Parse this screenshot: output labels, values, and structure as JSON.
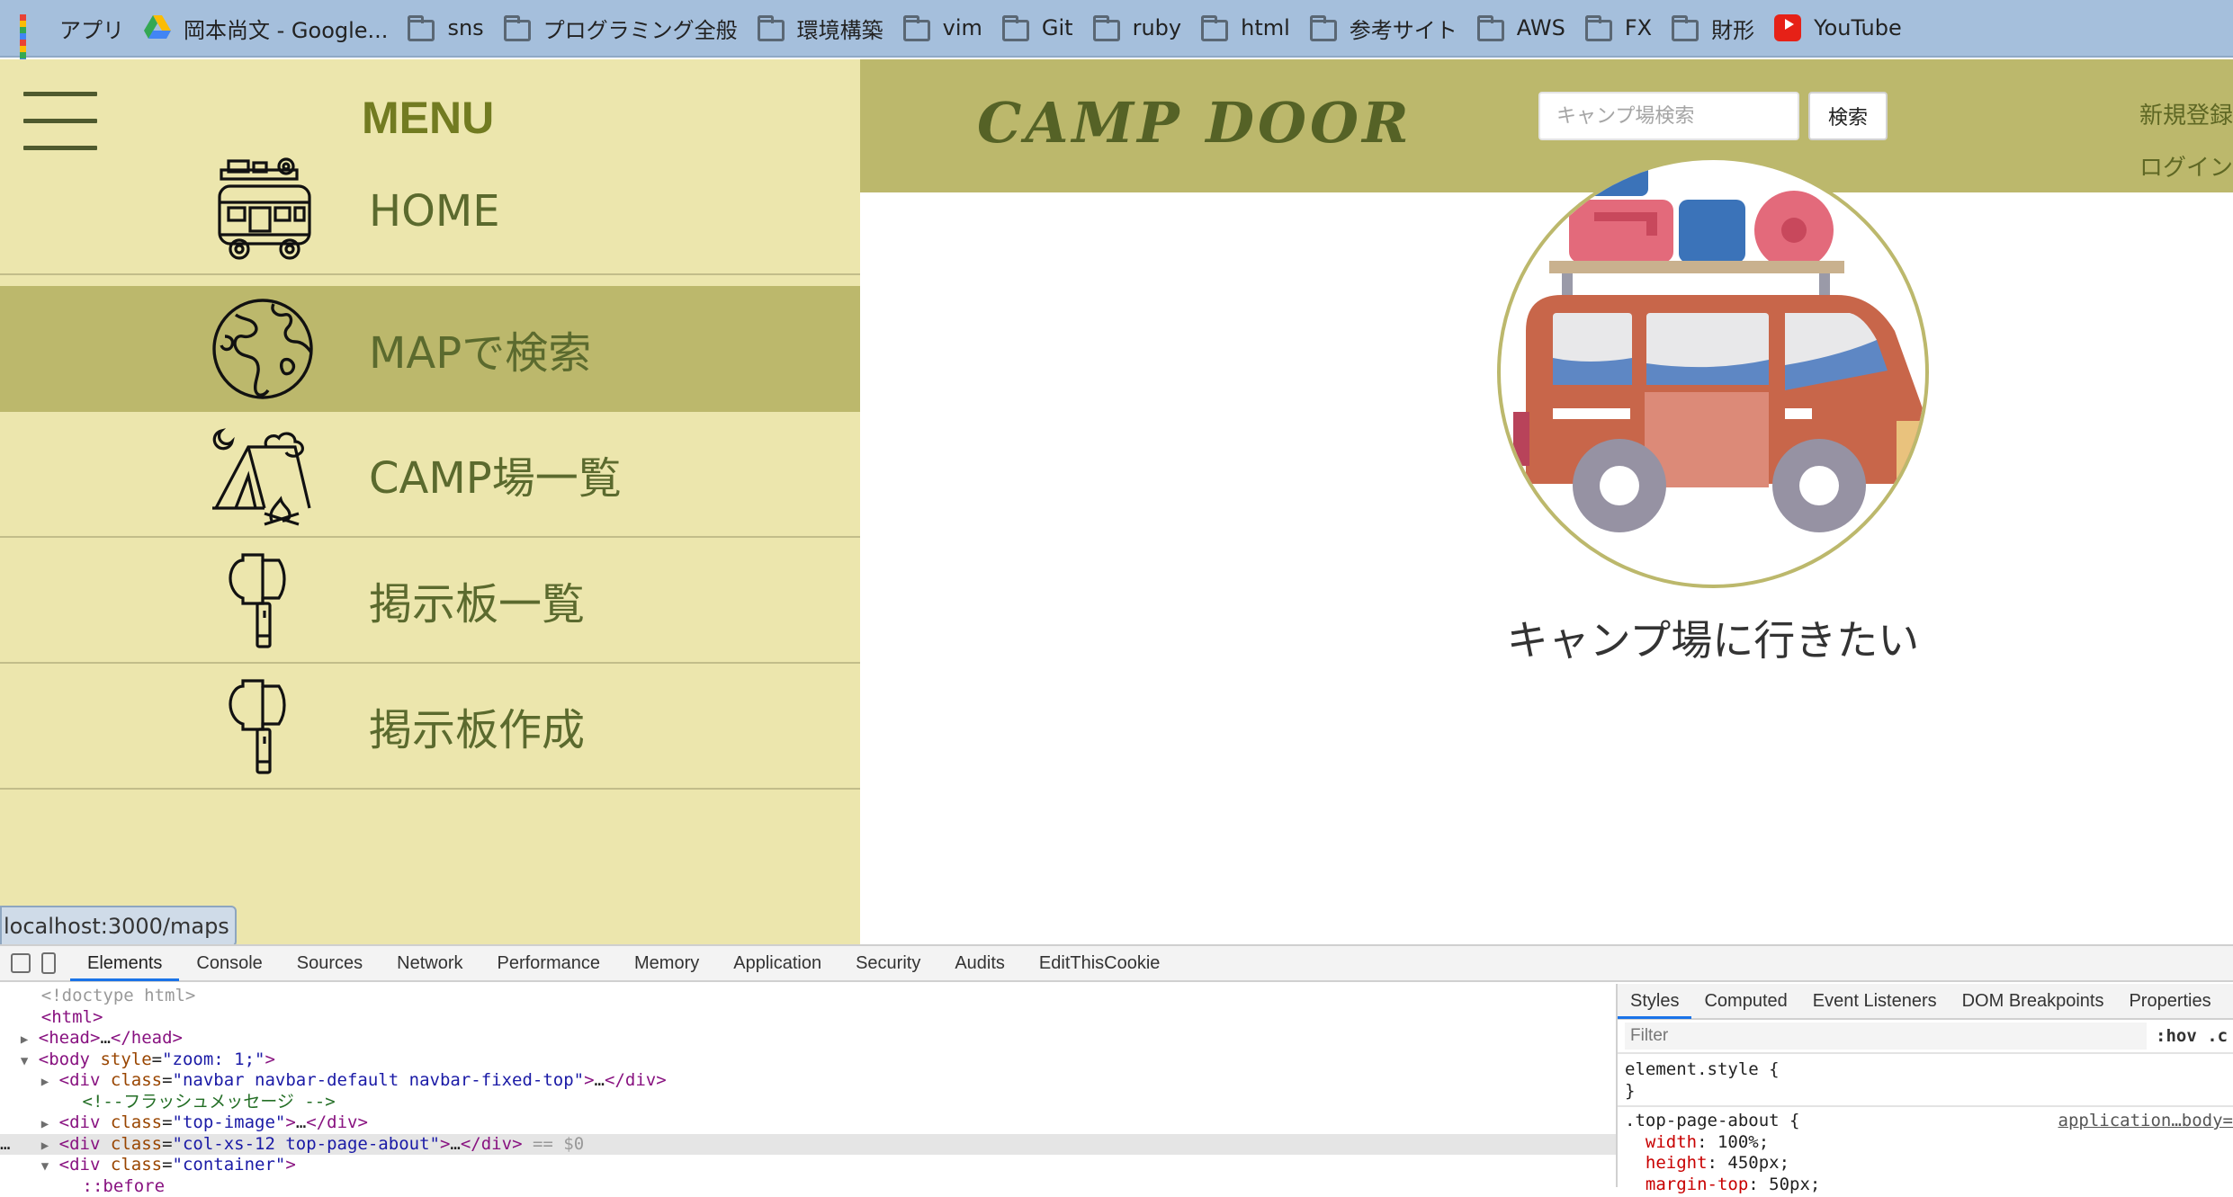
{
  "bookmarks": [
    {
      "label": "アプリ",
      "icon": "apps-grid-icon"
    },
    {
      "label": "岡本尚文 - Google...",
      "icon": "google-drive-icon"
    },
    {
      "label": "sns",
      "icon": "folder-icon"
    },
    {
      "label": "プログラミング全般",
      "icon": "folder-icon"
    },
    {
      "label": "環境構築",
      "icon": "folder-icon"
    },
    {
      "label": "vim",
      "icon": "folder-icon"
    },
    {
      "label": "Git",
      "icon": "folder-icon"
    },
    {
      "label": "ruby",
      "icon": "folder-icon"
    },
    {
      "label": "html",
      "icon": "folder-icon"
    },
    {
      "label": "参考サイト",
      "icon": "folder-icon"
    },
    {
      "label": "AWS",
      "icon": "folder-icon"
    },
    {
      "label": "FX",
      "icon": "folder-icon"
    },
    {
      "label": "財形",
      "icon": "folder-icon"
    },
    {
      "label": "YouTube",
      "icon": "youtube-icon"
    }
  ],
  "sidebar": {
    "title": "MENU",
    "items": [
      {
        "label": "HOME",
        "icon": "van-icon"
      },
      {
        "label": "MAPで検索",
        "icon": "globe-icon"
      },
      {
        "label": "CAMP場一覧",
        "icon": "tent-campfire-icon"
      },
      {
        "label": "掲示板一覧",
        "icon": "axe-icon"
      },
      {
        "label": "掲示板作成",
        "icon": "axe-icon"
      }
    ]
  },
  "header": {
    "logo": "CAMP DOOR",
    "search_placeholder": "キャンプ場検索",
    "search_button": "検索",
    "signup": "新規登録",
    "login": "ログイン"
  },
  "main": {
    "caption": "キャンプ場に行きたい"
  },
  "status_url": "localhost:3000/maps",
  "devtools": {
    "tabs": [
      "Elements",
      "Console",
      "Sources",
      "Network",
      "Performance",
      "Memory",
      "Application",
      "Security",
      "Audits",
      "EditThisCookie"
    ],
    "styles_tabs": [
      "Styles",
      "Computed",
      "Event Listeners",
      "DOM Breakpoints",
      "Properties"
    ],
    "filter_placeholder": "Filter",
    "hov_label": ":hov .c",
    "css_source": "application…body=",
    "css_selector": ".top-page-about {",
    "css_element_style": "element.style {",
    "css_close": "}",
    "css_props": [
      {
        "name": "width",
        "value": "100%;"
      },
      {
        "name": "height",
        "value": "450px;"
      },
      {
        "name": "margin-top",
        "value": "50px;"
      }
    ],
    "dom_lines": [
      {
        "indent": "  ",
        "arrow": "",
        "text": "<!doctype html>",
        "kind": "doctype"
      },
      {
        "indent": "  ",
        "arrow": "",
        "text": "<html>",
        "kind": "tag"
      },
      {
        "indent": "  ",
        "arrow": "▶",
        "text": "<head>…</head>",
        "kind": "tag"
      },
      {
        "indent": "  ",
        "arrow": "▼",
        "text": "<body style=\"zoom: 1;\">",
        "kind": "tag"
      },
      {
        "indent": "    ",
        "arrow": "▶",
        "text": "<div class=\"navbar navbar-default navbar-fixed-top\">…</div>",
        "kind": "tag"
      },
      {
        "indent": "      ",
        "arrow": "",
        "text": "<!--フラッシュメッセージ -->",
        "kind": "comment"
      },
      {
        "indent": "    ",
        "arrow": "▶",
        "text": "<div class=\"top-image\">…</div>",
        "kind": "tag"
      },
      {
        "indent": "…   ",
        "arrow": "▶",
        "text": "<div class=\"col-xs-12 top-page-about\">…</div> == $0",
        "kind": "tag-selected"
      },
      {
        "indent": "    ",
        "arrow": "▼",
        "text": "<div class=\"container\">",
        "kind": "tag"
      },
      {
        "indent": "      ",
        "arrow": "",
        "text": "::before",
        "kind": "pseudo"
      }
    ]
  },
  "colors": {
    "sidebar_bg": "#ece6ad",
    "header_bg": "#bcb86c",
    "sidebar_text": "#5b6a2e",
    "menu_title": "#727b21"
  }
}
